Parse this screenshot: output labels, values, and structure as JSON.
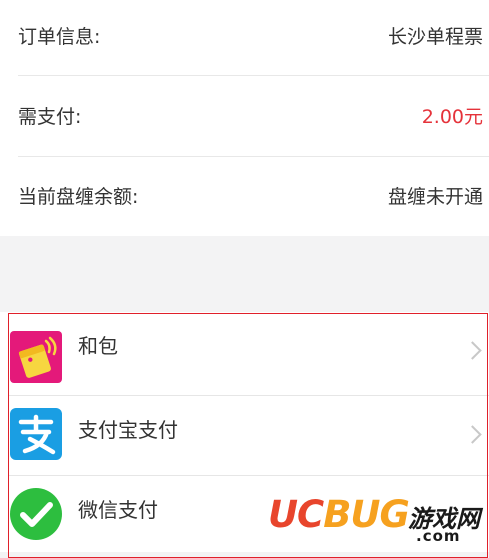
{
  "order_info": {
    "label": "订单信息:",
    "value": "长沙单程票"
  },
  "payment_due": {
    "label": "需支付:",
    "value": "2.00元",
    "value_color": "#e5323a"
  },
  "balance": {
    "label": "当前盘缠余额:",
    "value": "盘缠未开通"
  },
  "payment_methods": [
    {
      "label": "和包",
      "icon": "hebao-wallet-icon",
      "color": "#e4197a"
    },
    {
      "label": "支付宝支付",
      "icon": "alipay-icon",
      "color": "#1a9ee3"
    },
    {
      "label": "微信支付",
      "icon": "wechat-pay-icon",
      "color": "#2dbe3f"
    }
  ],
  "watermark": {
    "brand": "UCBUG",
    "brand_cn": "游戏网",
    "domain": ".com"
  }
}
